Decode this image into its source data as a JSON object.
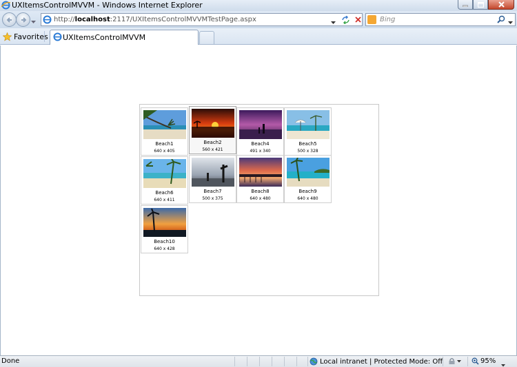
{
  "window": {
    "title": "UXItemsControlMVVM - Windows Internet Explorer"
  },
  "address_bar": {
    "url_prefix": "http://",
    "url_host": "localhost",
    "url_rest": ":2117/UXItemsControlMVVMTestPage.aspx"
  },
  "search": {
    "placeholder": "Bing"
  },
  "favorites": {
    "label": "Favorites"
  },
  "tab": {
    "label": "UXItemsControlMVVM"
  },
  "gallery": {
    "items": [
      {
        "name": "Beach1",
        "dims": "640 x 405"
      },
      {
        "name": "Beach2",
        "dims": "560 x 421"
      },
      {
        "name": "Beach4",
        "dims": "491 x 340"
      },
      {
        "name": "Beach5",
        "dims": "500 x 328"
      },
      {
        "name": "Beach6",
        "dims": "640 x 411"
      },
      {
        "name": "Beach7",
        "dims": "500 x 375"
      },
      {
        "name": "Beach8",
        "dims": "640 x 480"
      },
      {
        "name": "Beach9",
        "dims": "640 x 480"
      },
      {
        "name": "Beach10",
        "dims": "640 x 428"
      }
    ]
  },
  "status": {
    "text": "Done",
    "zone": "Local intranet | Protected Mode: Off",
    "zoom": "95%"
  }
}
